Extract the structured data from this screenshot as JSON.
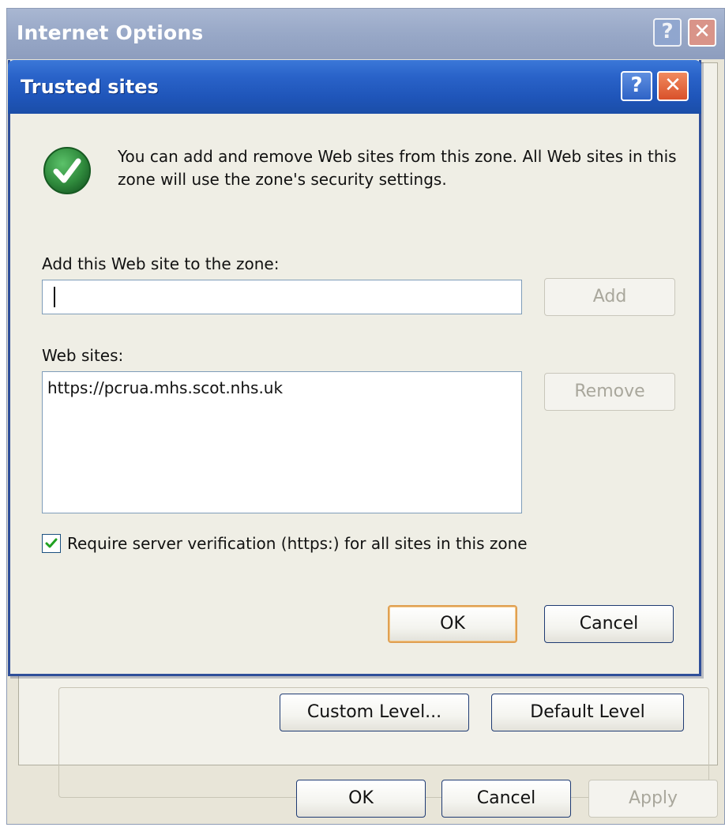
{
  "internet_options": {
    "title": "Internet Options",
    "help_glyph": "?",
    "close_glyph": "✕",
    "buttons": {
      "custom_level": "Custom Level...",
      "default_level": "Default Level",
      "ok": "OK",
      "cancel": "Cancel",
      "apply": "Apply"
    }
  },
  "trusted_sites": {
    "title": "Trusted sites",
    "help_glyph": "?",
    "close_glyph": "✕",
    "info_text": "You can add and remove Web sites from this zone. All Web sites in this zone will use the zone's security settings.",
    "info_icon": "green-checkmark-icon",
    "add_label": "Add this Web site to the zone:",
    "add_input_value": "",
    "add_button": "Add",
    "web_sites_label": "Web sites:",
    "web_sites": [
      "https://pcrua.mhs.scot.nhs.uk"
    ],
    "remove_button": "Remove",
    "require_https_label": "Require server verification (https:) for all sites in this zone",
    "require_https_checked": true,
    "ok_button": "OK",
    "cancel_button": "Cancel"
  },
  "colors": {
    "titlebar_active": "#2a63c9",
    "titlebar_inactive": "#98a8c7",
    "dialog_bg": "#efeee5",
    "check_green": "#2f8a3c",
    "default_button_border": "#e0a052"
  }
}
